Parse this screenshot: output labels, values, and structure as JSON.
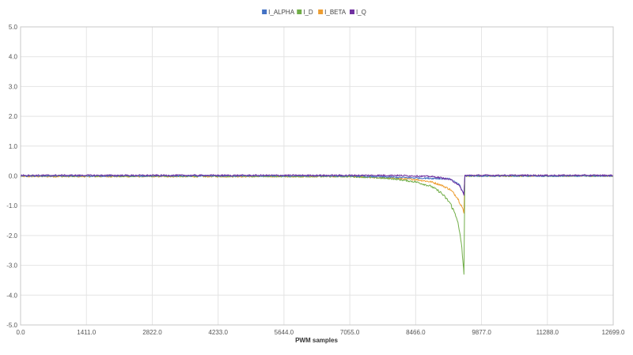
{
  "chart_data": {
    "type": "line",
    "title": "",
    "xlabel": "PWM samples",
    "ylabel": "",
    "xlim": [
      0,
      12699
    ],
    "ylim": [
      -5,
      5
    ],
    "grid": true,
    "legend_position": "top-center",
    "x_ticks": [
      0,
      1411,
      2822,
      4233,
      5644,
      7055,
      8466,
      9877,
      11288,
      12699
    ],
    "x_tick_labels": [
      "0.0",
      "1411.0",
      "2822.0",
      "4233.0",
      "5644.0",
      "7055.0",
      "8466.0",
      "9877.0",
      "11288.0",
      "12699.0"
    ],
    "y_ticks": [
      5,
      4,
      3,
      2,
      1,
      0,
      -1,
      -2,
      -3,
      -4,
      -5
    ],
    "y_tick_labels": [
      "5.0",
      "4.0",
      "3.0",
      "2.0",
      "1.0",
      "0.0",
      "-1.0",
      "-2.0",
      "-3.0",
      "-4.0",
      "-5.0"
    ],
    "series": [
      {
        "name": "I_ALPHA",
        "color": "#4472c4",
        "x": [
          0,
          7055,
          9200,
          9400,
          9500,
          9520,
          12699
        ],
        "y": [
          0.0,
          0.0,
          -0.1,
          -0.3,
          -0.6,
          0.0,
          0.0
        ]
      },
      {
        "name": "I_D",
        "color": "#70ad47",
        "x": [
          0,
          7055,
          7500,
          8000,
          8466,
          8800,
          9000,
          9200,
          9350,
          9450,
          9500,
          9520,
          12699
        ],
        "y": [
          0.0,
          -0.02,
          -0.05,
          -0.1,
          -0.2,
          -0.35,
          -0.55,
          -0.9,
          -1.4,
          -2.3,
          -3.3,
          0.0,
          0.0
        ]
      },
      {
        "name": "I_BETA",
        "color": "#ed9d31",
        "x": [
          0,
          7055,
          7500,
          8000,
          8466,
          8800,
          9000,
          9200,
          9350,
          9450,
          9500,
          9520,
          12699
        ],
        "y": [
          -0.02,
          -0.02,
          -0.05,
          -0.08,
          -0.12,
          -0.2,
          -0.3,
          -0.45,
          -0.7,
          -1.0,
          -1.25,
          0.0,
          0.0
        ]
      },
      {
        "name": "I_Q",
        "color": "#7030a0",
        "x": [
          0,
          7055,
          8000,
          8466,
          8800,
          9000,
          9200,
          9350,
          9450,
          9500,
          9520,
          12699
        ],
        "y": [
          0.02,
          0.02,
          0.02,
          0.0,
          -0.02,
          -0.06,
          -0.12,
          -0.25,
          -0.45,
          -0.65,
          0.02,
          0.02
        ]
      }
    ]
  }
}
